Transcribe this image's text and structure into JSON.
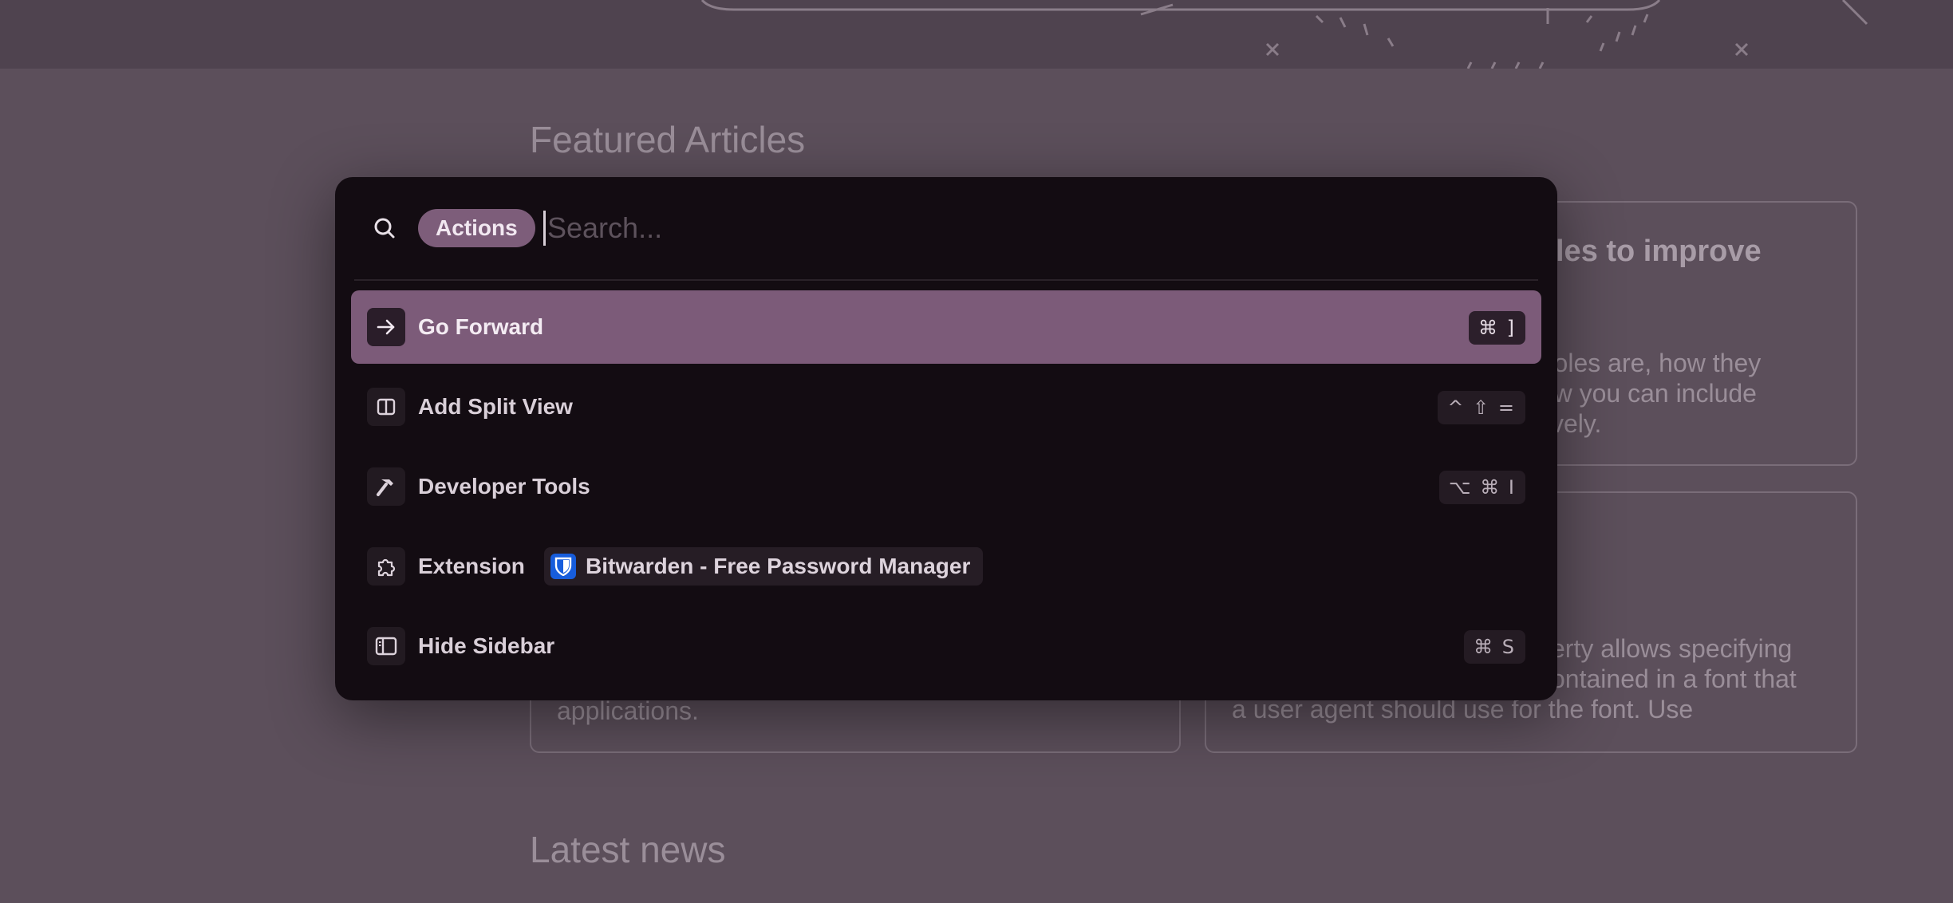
{
  "background": {
    "featured_heading": "Featured Articles",
    "latest_heading": "Latest news",
    "card1": {
      "title_fragment": "roles to improve",
      "text_lines": [
        "k roles are, how they",
        "how you can include",
        "ctively."
      ]
    },
    "card2": {
      "text_lines": [
        "erty allows specifying",
        "ontained in a font that",
        "a user agent should use for the font. Use"
      ]
    },
    "card3": {
      "text_fragment": "applications."
    }
  },
  "palette": {
    "mode_chip": "Actions",
    "search_placeholder": "Search...",
    "search_value": "",
    "items": [
      {
        "label": "Go Forward",
        "icon": "arrow-right-icon",
        "shortcut": "⌘ ]",
        "active": true
      },
      {
        "label": "Add Split View",
        "icon": "split-view-icon",
        "shortcut": "^ ⇧ =",
        "active": false
      },
      {
        "label": "Developer Tools",
        "icon": "hammer-icon",
        "shortcut": "⌥ ⌘ I",
        "active": false
      },
      {
        "label": "Extension",
        "icon": "puzzle-icon",
        "extension_name": "Bitwarden - Free Password Manager",
        "extension_icon": "bitwarden-shield-icon",
        "active": false
      },
      {
        "label": "Hide Sidebar",
        "icon": "sidebar-icon",
        "shortcut": "⌘ S",
        "active": false
      }
    ]
  },
  "colors": {
    "accent": "#7c5b79",
    "palette_bg": "#130c12",
    "page_bg": "#5c4f5b",
    "bitwarden_blue": "#175ddc"
  }
}
